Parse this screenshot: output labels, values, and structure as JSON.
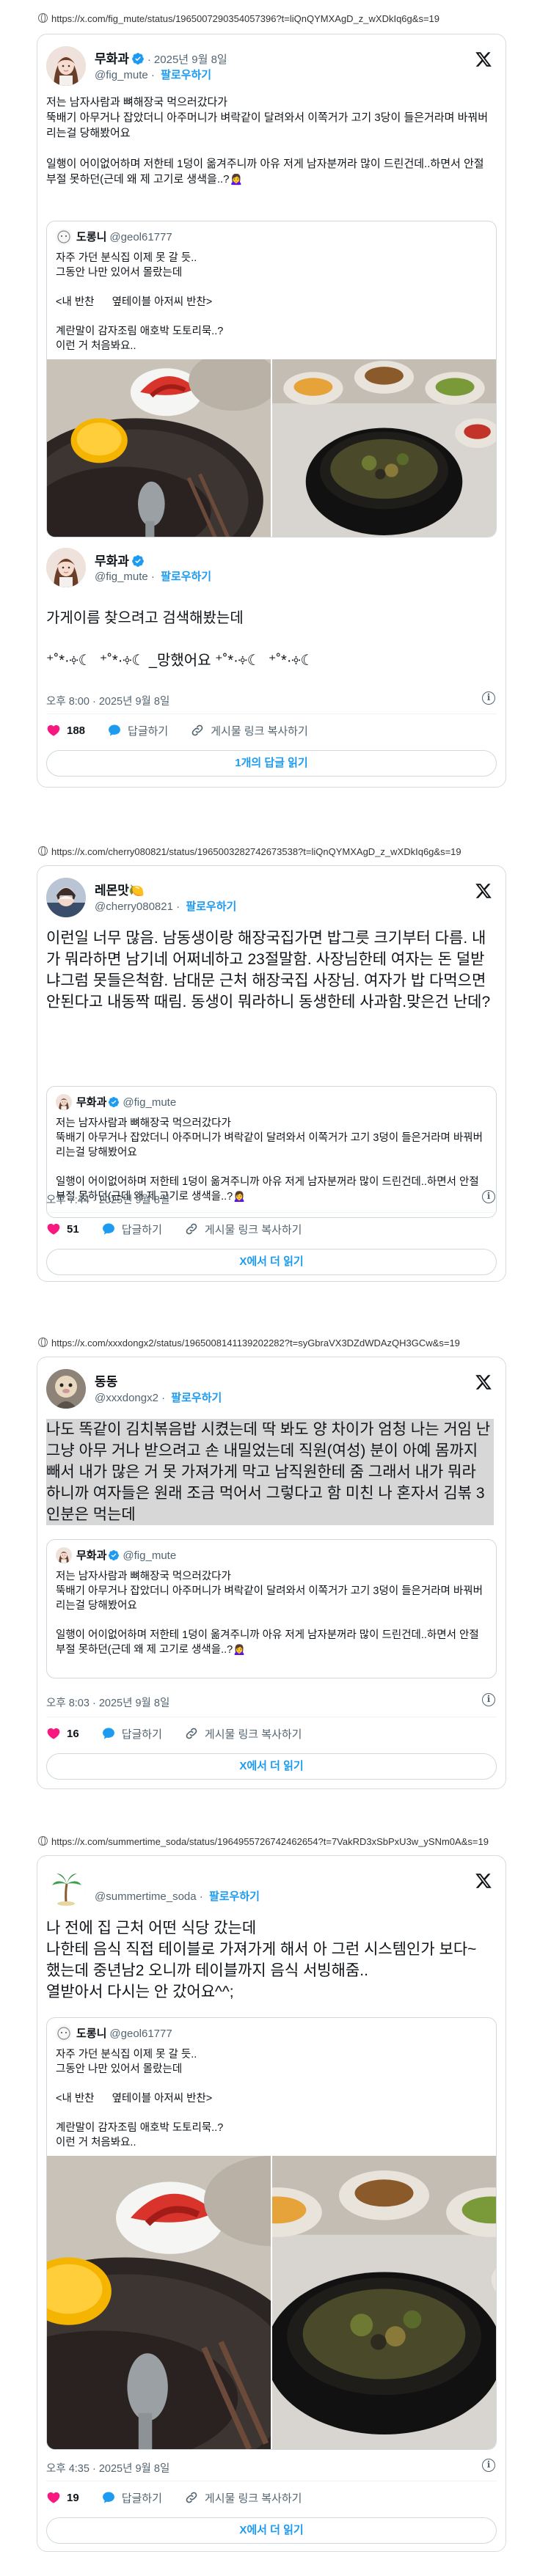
{
  "colors": {
    "accent": "#1d9bf0",
    "like": "#f91880",
    "verified": "#1d9bf0",
    "muted": "#536471"
  },
  "common": {
    "follow_label": "팔로우하기",
    "reply_label": "답글하기",
    "copy_link_label": "게시물 링크 복사하기",
    "x_logo": "x-logo-icon",
    "info_icon": "i"
  },
  "tweets": [
    {
      "url": "https://x.com/fig_mute/status/1965007290354057396?t=liQnQYMXAgD_z_wXDkIq6g&s=19",
      "author": {
        "name": "무화과",
        "handle": "@fig_mute",
        "date": "2025년 9월 8일",
        "verified": true
      },
      "text": "저는 남자사람과 뼈해장국 먹으러갔다가\n뚝배기 아무거나 잡았더니 아주머니가 벼락같이 달려와서 이쪽거가 고기 3당이 들은거라며 바꿔버리는걸 당해봤어요\n\n일행이 어이없어하며 저한테 1덩이 옮겨주니까 아유 저게 남자분꺼라 많이 드린건데..하면서 안절부절 못하던(근데 왜 제 고기로 생색을..?🙍‍♀️",
      "quote": {
        "name": "도롱니",
        "handle": "@geol61777",
        "text": "자주 가던 분식집 이제 못 갈 듯..\n그동안 나만 있어서 몰랐는데\n\n<내 반찬      옆테이블 아저씨 반찬>\n\n계란말이 감자조림 애호박 도토리묵..?\n이런 거 처음봐요.."
      },
      "reply": {
        "name": "무화과",
        "handle": "@fig_mute",
        "text": "가게이름 찾으려고 검색해봤는데\n\n⁺˚*·༓☾  ⁺˚*·༓☾ _망했어요 ⁺˚*·༓☾  ⁺˚*·༓☾",
        "time": "오후 8:00 · 2025년 9월 8일",
        "likes": "188",
        "more": "1개의 답글 읽기"
      }
    },
    {
      "url": "https://x.com/cherry080821/status/1965003282742673538?t=liQnQYMXAgD_z_wXDkIq6g&s=19",
      "author": {
        "name": "레몬맛🍋",
        "handle": "@cherry080821"
      },
      "text": "이런일 너무 많음. 남동생이랑 해장국집가면 밥그릇 크기부터 다름. 내가 뭐라하면 남기네 어쩌네하고 23절말함. 사장님한테 여자는 돈 덜받냐그럼 못들은척함. 남대문 근처 해장국집 사장님. 여자가 밥 다먹으면 안된다고 내동짝 때림. 동생이 뭐라하니 동생한테 사과함.맞은건 난데?",
      "quote": {
        "name": "무화과",
        "handle": "@fig_mute",
        "text": "저는 남자사람과 뼈해장국 먹으러갔다가\n뚝배기 아무거나 잡았더니 아주머니가 벼락같이 달려와서 이쪽거가 고기 3덩이 들은거라며 바꿔버리는걸 당해봤어요\n\n일행이 어이없어하며 저한테 1덩이 옮겨주니까 아유 저게 남자분꺼라 많이 드린건데..하면서 안절부절 못하던(근데 왜 제 고기로 생색을..?🙍‍♀️"
      },
      "time": "오후 7:44 · 2025년 9월 8일",
      "likes": "51",
      "more": "X에서 더 읽기"
    },
    {
      "url": "https://x.com/xxxdongx2/status/1965008141139202282?t=syGbraVX3DZdWDAzQH3GCw&s=19",
      "author": {
        "name": "동동",
        "handle": "@xxxdongx2"
      },
      "text": "나도 똑같이 김치볶음밥 시켰는데 딱 봐도 양 차이가 엄청 나는 거임 난 그냥 아무 거나 받으려고 손 내밀었는데 직원(여성) 분이 아예 몸까지 빼서 내가 많은 거 못 가져가게 막고 남직원한테 줌 그래서 내가 뭐라 하니까 여자들은 원래 조금 먹어서 그렇다고 함 미친 나 혼자서 김볶 3인분은 먹는데",
      "quote": {
        "name": "무화과",
        "handle": "@fig_mute",
        "text": "저는 남자사람과 뼈해장국 먹으러갔다가\n뚝배기 아무거나 잡았더니 아주머니가 벼락같이 달려와서 이쪽거가 고기 3덩이 들은거라며 바꿔버리는걸 당해봤어요\n\n일행이 어이없어하며 저한테 1덩이 옮겨주니까 아유 저게 남자분꺼라 많이 드린건데..하면서 안절부절 못하던(근데 왜 제 고기로 생색을..?🙍‍♀️"
      },
      "time": "오후 8:03 · 2025년 9월 8일",
      "likes": "16",
      "more": "X에서 더 읽기"
    },
    {
      "url": "https://x.com/summertime_soda/status/1964955726742462654?t=7VakRD3xSbPxU3w_ySNm0A&s=19",
      "author": {
        "name": "",
        "handle": "@summertime_soda"
      },
      "text": "나 전에 집 근처 어떤 식당 갔는데\n나한테 음식 직접 테이블로 가져가게 해서 아 그런 시스템인가 보다~ 했는데 중년남2 오니까 테이블까지 음식 서빙해줌..\n열받아서 다시는 안 갔어요^^;",
      "quote": {
        "name": "도롱니",
        "handle": "@geol61777",
        "text": "자주 가던 분식집 이제 못 갈 듯..\n그동안 나만 있어서 몰랐는데\n\n<내 반찬      옆테이블 아저씨 반찬>\n\n계란말이 감자조림 애호박 도토리묵..?\n이런 거 처음봐요.."
      },
      "time": "오후 4:35 · 2025년 9월 8일",
      "likes": "19",
      "more": "X에서 더 읽기"
    }
  ]
}
